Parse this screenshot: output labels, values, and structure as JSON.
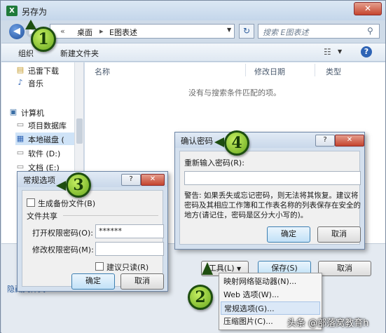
{
  "window": {
    "title": "另存为",
    "close_glyph": "✕"
  },
  "address": {
    "separator": "«",
    "path": [
      "桌面",
      "E图表述"
    ],
    "search_placeholder": "搜索 E图表述"
  },
  "toolbar": {
    "organize": "组织",
    "new_folder": "新建文件夹"
  },
  "nav_pane": {
    "items": [
      {
        "label": "迅雷下载",
        "icon": "download-folder-icon"
      },
      {
        "label": "音乐",
        "icon": "music-icon"
      },
      {
        "label": "计算机",
        "icon": "computer-icon"
      },
      {
        "label": "项目数据库",
        "icon": "drive-icon"
      },
      {
        "label": "本地磁盘 (",
        "icon": "disk-icon"
      },
      {
        "label": "软件 (D:)",
        "icon": "drive-icon"
      },
      {
        "label": "文档 (E:)",
        "icon": "drive-icon"
      }
    ]
  },
  "file_list": {
    "columns": [
      "名称",
      "修改日期",
      "类型"
    ],
    "empty_message": "没有与搜索条件匹配的项。"
  },
  "buttons": {
    "tools": "工具(L)",
    "tools_arrow": "▼",
    "save": "保存(S)",
    "cancel": "取消"
  },
  "footer": {
    "hide_folders": "隐藏文件夹"
  },
  "tools_menu": {
    "items": [
      "映射网络驱动器(N)...",
      "Web 选项(W)...",
      "常规选项(G)...",
      "压缩图片(C)..."
    ],
    "highlighted_index": 2
  },
  "confirm_dialog": {
    "title": "确认密码",
    "help": "?",
    "close": "✕",
    "reenter_label": "重新输入密码(R):",
    "warning": "警告: 如果丢失或忘记密码，则无法将其恢复。建议将密码及其相应工作簿和工作表名称的列表保存在安全的地方(请记住，密码是区分大小写的)。",
    "ok": "确定",
    "cancel": "取消"
  },
  "general_dialog": {
    "title": "常规选项",
    "help": "?",
    "close": "✕",
    "backup_label": "生成备份文件(B)",
    "file_sharing": "文件共享",
    "open_password_label": "打开权限密码(O):",
    "open_password_value": "******",
    "modify_password_label": "修改权限密码(M):",
    "read_only_label": "建议只读(R)",
    "ok": "确定",
    "cancel": "取消"
  },
  "callouts": [
    "1",
    "2",
    "3",
    "4"
  ],
  "watermark": "头条 @部落窝教育h",
  "colors": {
    "badge_fill": "#8ccf3a",
    "badge_border": "#1e4e10",
    "accent": "#2f64b5"
  }
}
